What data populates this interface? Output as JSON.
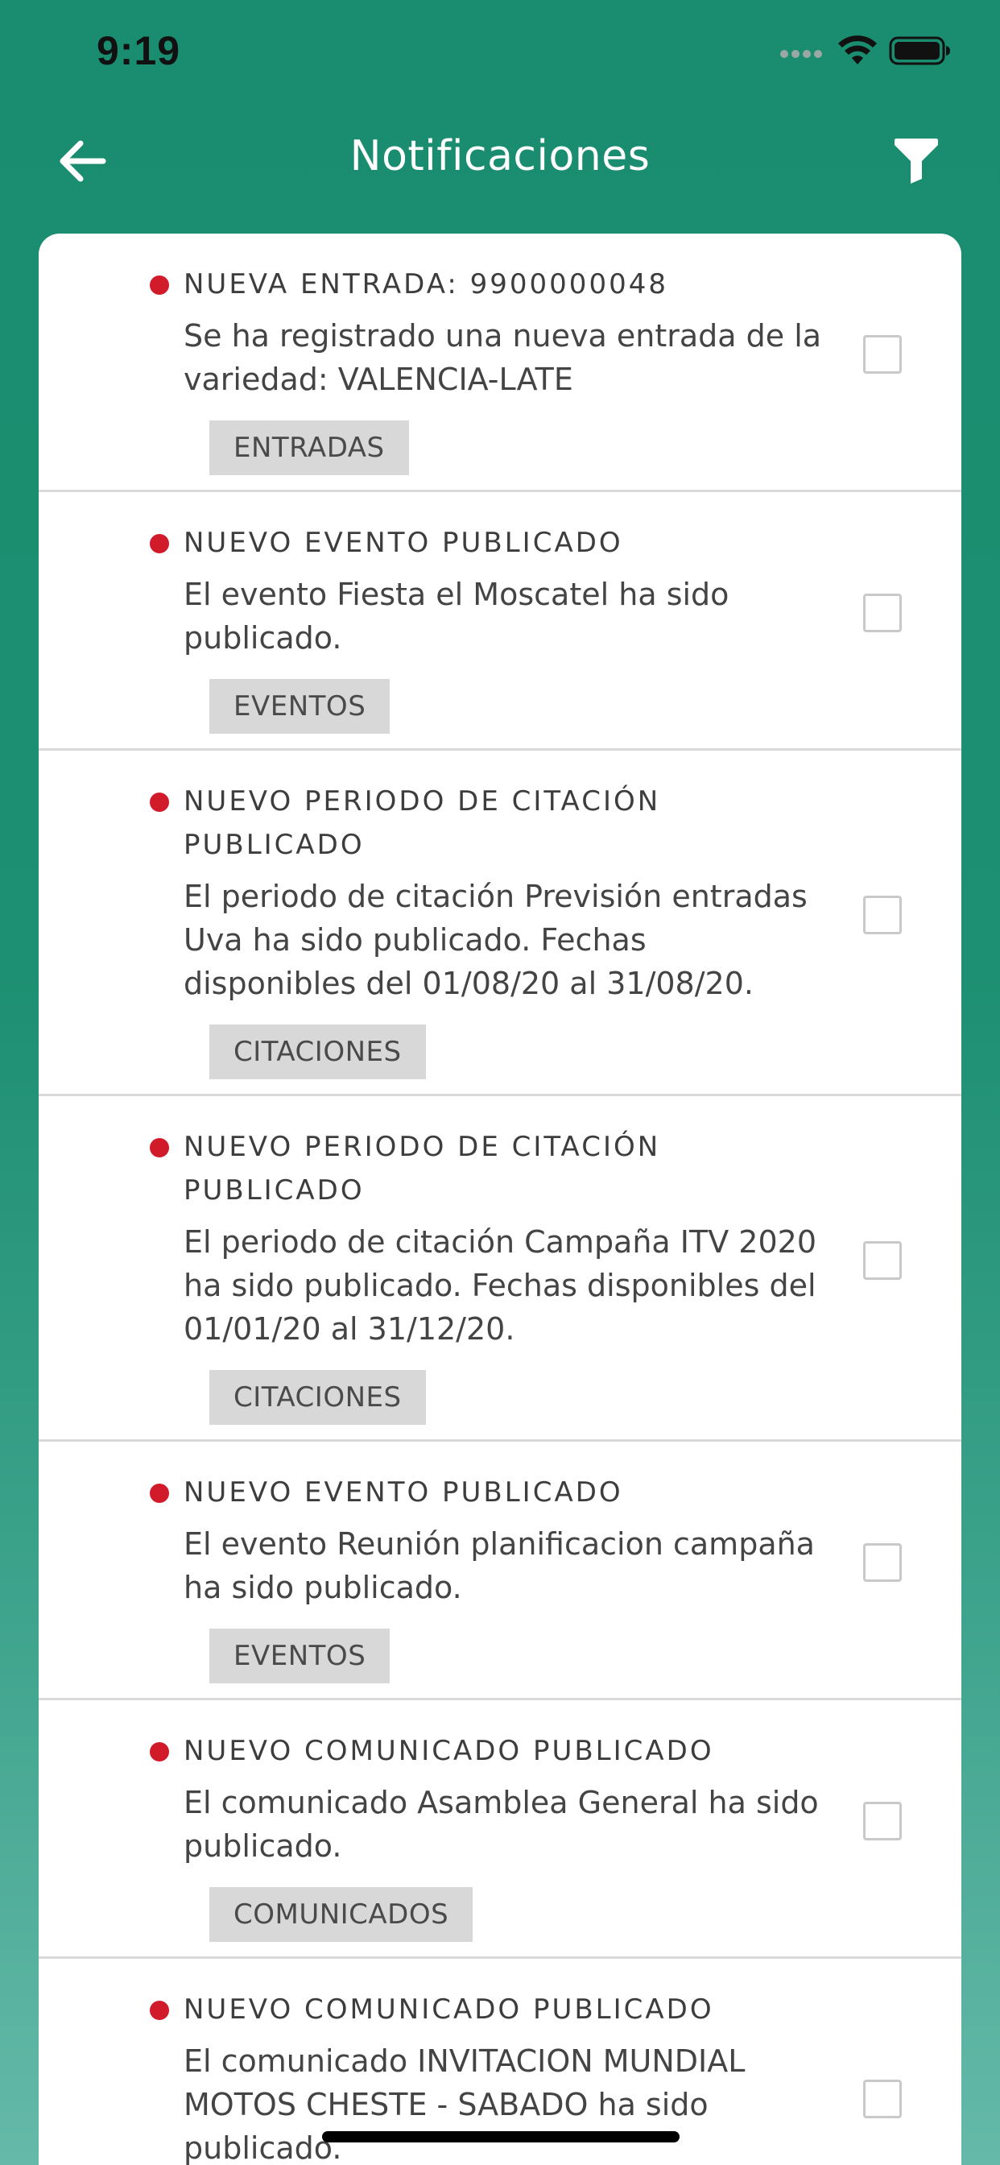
{
  "status_bar": {
    "time": "9:19"
  },
  "header": {
    "title": "Notificaciones",
    "back_icon": "arrow-left-icon",
    "filter_icon": "filter-funnel-icon"
  },
  "colors": {
    "header_bg": "#1a8c6f",
    "dot": "#d11a2a",
    "tag_bg": "#d8d8d8"
  },
  "notifications": [
    {
      "title": "NUEVA ENTRADA: 9900000048",
      "body": "Se ha registrado una nueva entrada de la variedad: VALENCIA-LATE",
      "tag": "ENTRADAS",
      "checked": false
    },
    {
      "title": "NUEVO EVENTO PUBLICADO",
      "body": "El evento Fiesta el Moscatel ha sido publicado.",
      "tag": "EVENTOS",
      "checked": false
    },
    {
      "title": "NUEVO PERIODO DE CITACIÓN PUBLICADO",
      "body": "El periodo de citación Previsión entradas Uva ha sido publicado. Fechas disponibles del 01/08/20 al 31/08/20.",
      "tag": "CITACIONES",
      "checked": false
    },
    {
      "title": "NUEVO PERIODO DE CITACIÓN PUBLICADO",
      "body": "El periodo de citación Campaña ITV 2020 ha sido publicado. Fechas disponibles del 01/01/20 al 31/12/20.",
      "tag": "CITACIONES",
      "checked": false
    },
    {
      "title": "NUEVO EVENTO PUBLICADO",
      "body": "El evento Reunión planificacion campaña ha sido publicado.",
      "tag": "EVENTOS",
      "checked": false
    },
    {
      "title": "NUEVO COMUNICADO PUBLICADO",
      "body": "El comunicado Asamblea General ha sido publicado.",
      "tag": "COMUNICADOS",
      "checked": false
    },
    {
      "title": "NUEVO COMUNICADO PUBLICADO",
      "body": "El comunicado INVITACION MUNDIAL MOTOS CHESTE - SABADO ha sido publicado.",
      "tag": "",
      "checked": false
    }
  ]
}
